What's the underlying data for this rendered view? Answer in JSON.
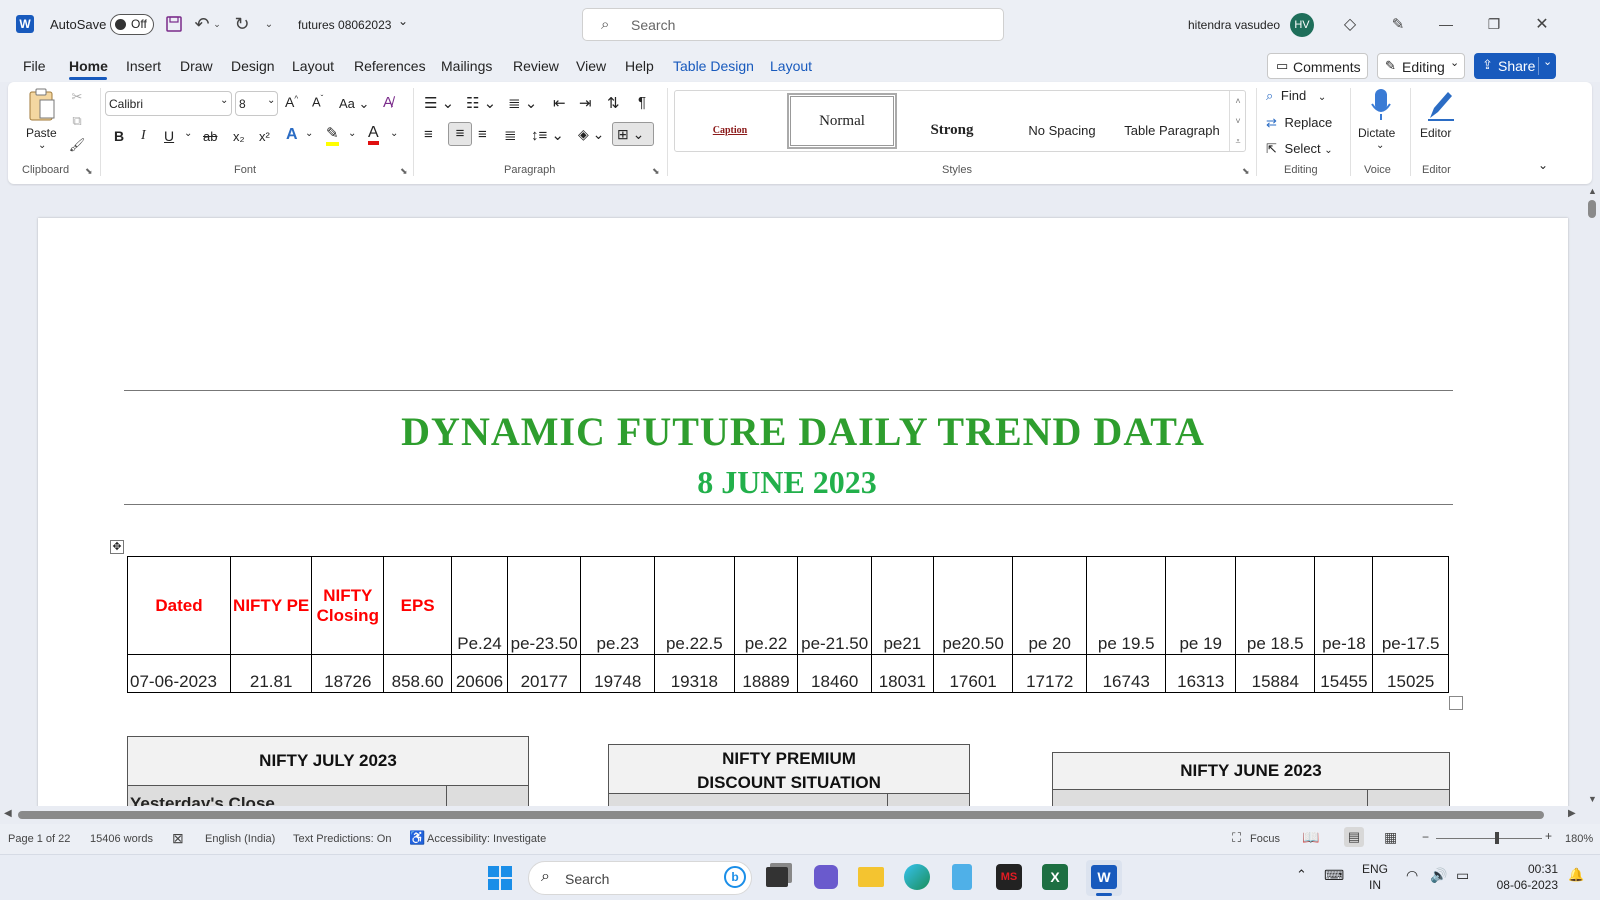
{
  "titlebar": {
    "autosave_label": "AutoSave",
    "autosave_state": "Off",
    "doc_name": "futures 08062023",
    "search_placeholder": "Search",
    "user_name": "hitendra vasudeo",
    "user_initials": "HV"
  },
  "menu": {
    "items": [
      "File",
      "Home",
      "Insert",
      "Draw",
      "Design",
      "Layout",
      "References",
      "Mailings",
      "Review",
      "View",
      "Help",
      "Table Design",
      "Layout"
    ],
    "comments_label": "Comments",
    "editing_label": "Editing",
    "share_label": "Share"
  },
  "ribbon": {
    "clipboard": {
      "paste": "Paste",
      "label": "Clipboard"
    },
    "font": {
      "name": "Calibri",
      "size": "8",
      "label": "Font",
      "grow": "A^",
      "shrink": "Aˇ",
      "case": "Aa",
      "bold": "B",
      "italic": "I",
      "underline": "U",
      "strike": "ab",
      "sub": "x₂",
      "sup": "x²"
    },
    "paragraph": {
      "label": "Paragraph"
    },
    "styles": {
      "items": [
        "Caption",
        "Normal",
        "Strong",
        "No Spacing",
        "Table Paragraph"
      ],
      "label": "Styles"
    },
    "editing": {
      "find": "Find",
      "replace": "Replace",
      "select": "Select",
      "label": "Editing"
    },
    "voice": {
      "dictate": "Dictate",
      "label": "Voice"
    },
    "editor": {
      "button": "Editor",
      "label": "Editor"
    }
  },
  "document": {
    "title": "DYNAMIC FUTURE DAILY TREND DATA",
    "date": "8 JUNE 2023",
    "table": {
      "headers": [
        "Dated",
        "NIFTY PE",
        "NIFTY Closing",
        "EPS",
        "Pe.24",
        "pe-23.50",
        "pe.23",
        "pe.22.5",
        "pe.22",
        "pe-21.50",
        "pe21",
        "pe20.50",
        "pe 20",
        "pe 19.5",
        "pe 19",
        "pe 18.5",
        "pe-18",
        "pe-17.5"
      ],
      "row": [
        "07-06-2023",
        "21.81",
        "18726",
        "858.60",
        "20606",
        "20177",
        "19748",
        "19318",
        "18889",
        "18460",
        "18031",
        "17601",
        "17172",
        "16743",
        "16313",
        "15884",
        "15455",
        "15025"
      ]
    },
    "box1_title": "NIFTY JULY 2023",
    "box1_partial": "Yesterday's Close",
    "box2_title_line1": "NIFTY PREMIUM",
    "box2_title_line2": "DISCOUNT SITUATION",
    "box3_title": "NIFTY JUNE 2023"
  },
  "status": {
    "page": "Page 1 of 22",
    "words": "15406 words",
    "language": "English (India)",
    "predictions": "Text Predictions: On",
    "accessibility": "Accessibility: Investigate",
    "focus": "Focus",
    "zoom": "180%"
  },
  "taskbar": {
    "search_label": "Search",
    "lang_line1": "ENG",
    "lang_line2": "IN",
    "time": "00:31",
    "date": "08-06-2023"
  },
  "colors": {
    "accent": "#185abd",
    "header_red": "#ff0000",
    "title_green": "#2e9e2e",
    "date_green": "#22b04b"
  }
}
